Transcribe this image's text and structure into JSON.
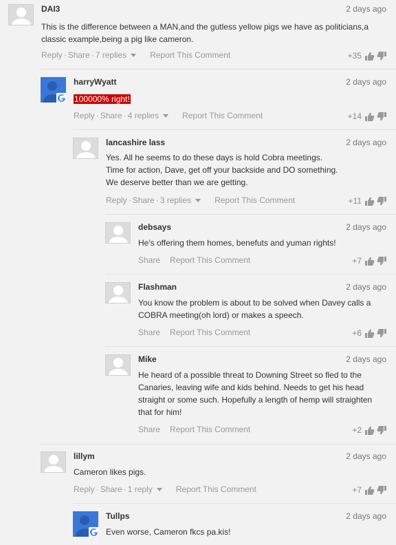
{
  "comments": [
    {
      "id": "c1",
      "user": "DAI3",
      "date": "2 days ago",
      "text": "This is the difference between a MAN,and the gutless yellow pigs we have as politicians,a classic example,being a pig like cameron.",
      "reply": "Reply",
      "share": "Share",
      "replies": "7 replies",
      "report": "Report This Comment",
      "votes": "+35"
    },
    {
      "id": "c2",
      "user": "harryWyatt",
      "date": "2 days ago",
      "text": "100000% right!",
      "reply": "Reply",
      "share": "Share",
      "replies": "4 replies",
      "report": "Report This Comment",
      "votes": "+14"
    },
    {
      "id": "c3",
      "user": "lancashire lass",
      "date": "2 days ago",
      "text": "Yes. All he seems to do these days is hold Cobra meetings.\nTime for action, Dave, get off your backside and DO something.\nWe deserve better than we are getting.",
      "reply": "Reply",
      "share": "Share",
      "replies": "3 replies",
      "report": "Report This Comment",
      "votes": "+11"
    },
    {
      "id": "c4",
      "user": "debsays",
      "date": "2 days ago",
      "text": "He's offering them homes, benefuts and yuman rights!",
      "share": "Share",
      "report": "Report This Comment",
      "votes": "+7"
    },
    {
      "id": "c5",
      "user": "Flashman",
      "date": "2 days ago",
      "text": "You know the problem is about to be solved when Davey calls a COBRA meeting(oh lord) or makes a speech.",
      "share": "Share",
      "report": "Report This Comment",
      "votes": "+6"
    },
    {
      "id": "c6",
      "user": "Mike",
      "date": "2 days ago",
      "text": "He heard of a possible threat to Downing Street so fled to the Canaries, leaving wife and kids behind. Needs to get his head straight or some such. Hopefully a length of hemp will straighten that for him!",
      "share": "Share",
      "report": "Report This Comment",
      "votes": "+2"
    },
    {
      "id": "c7",
      "user": "lillym",
      "date": "2 days ago",
      "text": "Cameron likes pigs.",
      "reply": "Reply",
      "share": "Share",
      "replies": "1 reply",
      "report": "Report This Comment",
      "votes": "+7"
    },
    {
      "id": "c8",
      "user": "Tullps",
      "date": "2 days ago",
      "text": "Even worse, Cameron fkcs pa.kis!"
    }
  ],
  "icons": {
    "thumbs_up": "thumbs-up-icon",
    "thumbs_down": "thumbs-down-icon",
    "avatar": "default-avatar-icon",
    "google": "google-badge-icon"
  },
  "colors": {
    "highlight": "#cc0000",
    "google_avatar": "#3a77d8"
  }
}
